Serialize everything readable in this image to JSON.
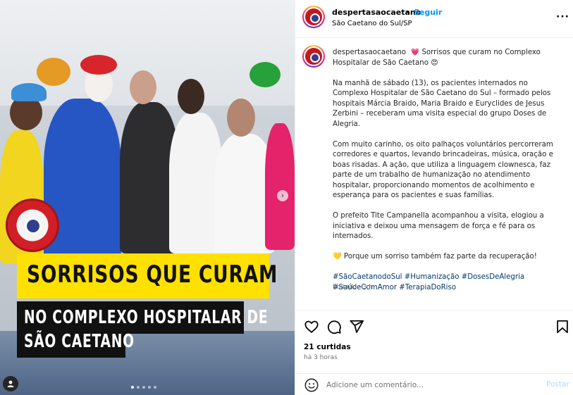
{
  "header": {
    "username": "despertasaocaetano",
    "separator": "•",
    "follow_label": "Seguir",
    "location": "São Caetano do Sul/SP",
    "more_icon": "more-options-icon"
  },
  "media": {
    "banner_line1": "SORRISOS QUE CURAM",
    "banner_line2": "NO COMPLEXO HOSPITALAR DE",
    "banner_line3": "SÃO CAETANO",
    "carousel_position": 1,
    "carousel_total": 5,
    "tag_icon": "user-tag-icon",
    "next_icon": "chevron-right-icon"
  },
  "caption": {
    "username": "despertasaocaetano",
    "intro": "💗 Sorrisos que curam no Complexo Hospitalar de São Caetano 😍",
    "paragraph1": "Na manhã de sábado (13), os pacientes internados no Complexo Hospitalar de São Caetano do Sul – formado pelos hospitais Márcia Braido, Maria Braido e Euryclides de Jesus Zerbini – receberam uma visita especial do grupo Doses de Alegria.",
    "paragraph2": "Com muito carinho, os oito palhaços voluntários percorreram corredores e quartos, levando brincadeiras, música, oração e boas risadas. A ação, que utiliza a linguagem clownesca, faz parte de um trabalho de humanização no atendimento hospitalar, proporcionando momentos de acolhimento e esperança para os pacientes e suas famílias.",
    "paragraph3": "O prefeito Tite Campanella acompanhou a visita, elogiou a iniciativa e deixou uma mensagem de força e fé para os internados.",
    "paragraph4": "💛 Porque um sorriso também faz parte da recuperação!",
    "hashtags": "#SãoCaetanodoSul #Humanização #DosesDeAlegria #SaúdeComAmor #TerapiaDoRiso",
    "edited": "Editado · 3 h"
  },
  "actions": {
    "icons": [
      "heart-icon",
      "comment-icon",
      "share-icon",
      "bookmark-icon"
    ],
    "likes": "21 curtidas",
    "time": "há 3 horas"
  },
  "comment": {
    "placeholder": "Adicione um comentário...",
    "post_label": "Postar",
    "emoji_icon": "emoji-icon"
  },
  "colors": {
    "accent_blue": "#0095f6",
    "banner_yellow": "#ffe100",
    "banner_black": "#111111",
    "hashtag": "#00376b"
  }
}
